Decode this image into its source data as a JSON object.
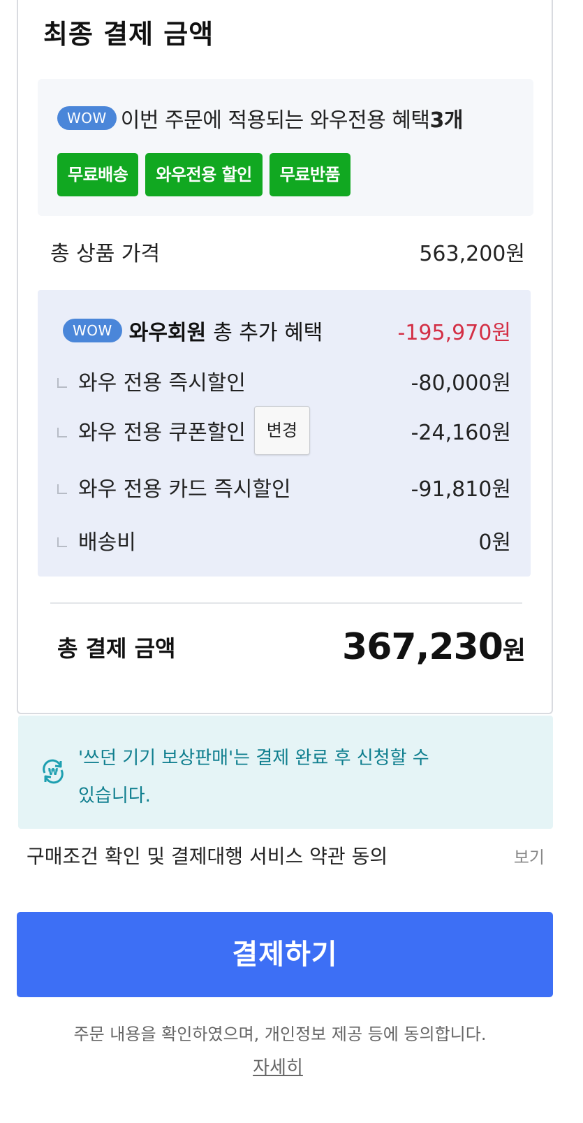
{
  "summary": {
    "title": "최종 결제 금액",
    "wow": {
      "badge": "WOW",
      "headline": "이번 주문에 적용되는 와우전용 혜택",
      "count": "3개",
      "tags": [
        "무료배송",
        "와우전용 할인",
        "무료반품"
      ]
    },
    "product_price": {
      "label": "총 상품 가격",
      "value": "563,200원"
    },
    "benefits": {
      "badge": "WOW",
      "member_label": "와우회원",
      "label": "총 추가 혜택",
      "total": "-195,970원",
      "items": [
        {
          "label": "와우 전용 즉시할인",
          "value": "-80,000원"
        },
        {
          "label": "와우 전용 쿠폰할인",
          "value": "-24,160원",
          "button": "변경"
        },
        {
          "label": "와우 전용 카드 즉시할인",
          "value": "-91,810원"
        },
        {
          "label": "배송비",
          "value": "0원"
        }
      ]
    },
    "total": {
      "label": "총 결제 금액",
      "amount": "367,230",
      "unit": "원"
    }
  },
  "notice": {
    "icon": "trade-in-won-icon",
    "line1": "'쓰던 기기 보상판매'는 결제 완료 후 신청할 수",
    "line2": "있습니다."
  },
  "terms": {
    "label": "구매조건 확인 및 결제대행 서비스 약관 동의",
    "view": "보기"
  },
  "pay_button": "결제하기",
  "footer": {
    "note": "주문 내용을 확인하였으며, 개인정보 제공 등에 동의합니다.",
    "link": "자세히"
  },
  "colors": {
    "wow_badge": "#4a86d9",
    "tag_green": "#11a821",
    "negative": "#d32f45",
    "pay_blue": "#3d6ff5",
    "notice_text": "#0e7e8e"
  }
}
